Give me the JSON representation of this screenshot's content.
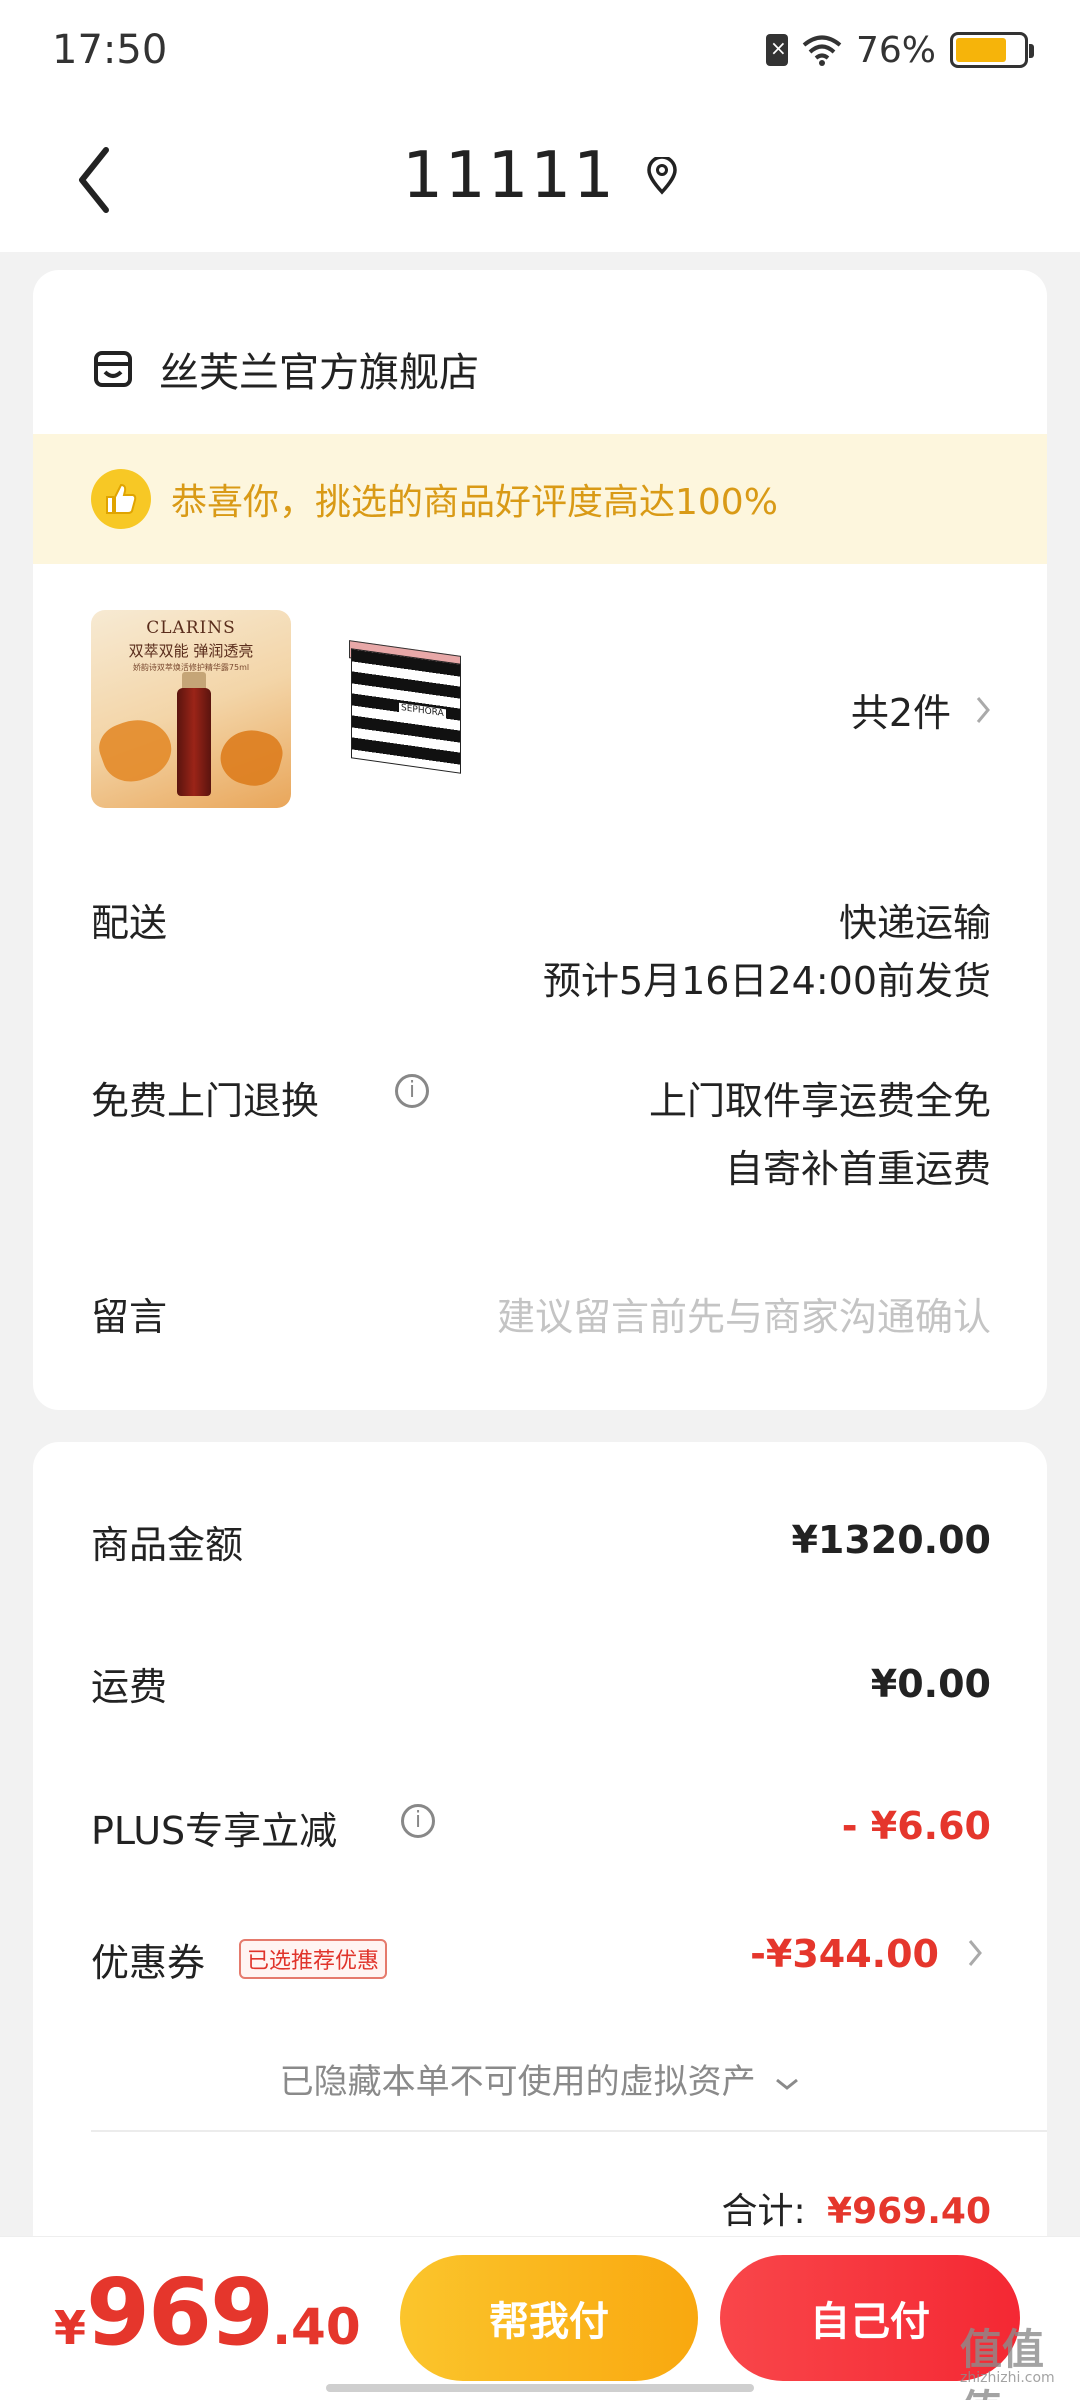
{
  "status_bar": {
    "time": "17:50",
    "battery": "76%",
    "battery_level": 0.76
  },
  "header": {
    "title": "11111"
  },
  "store": {
    "name": "丝芙兰官方旗舰店"
  },
  "banner": {
    "text": "恭喜你，挑选的商品好评度高达100%"
  },
  "products": {
    "item1": {
      "brand": "CLARINS",
      "tag": "双萃双能 弹润透亮",
      "sub": "娇韵诗双萃焕活修护精华露75ml"
    },
    "item2": {
      "label": "SEPHORA"
    },
    "count_text": "共2件"
  },
  "delivery": {
    "label": "配送",
    "method": "快递运输",
    "eta": "预计5月16日24:00前发货"
  },
  "returns": {
    "label": "免费上门退换",
    "line1": "上门取件享运费全免",
    "line2": "自寄补首重运费"
  },
  "remark": {
    "label": "留言",
    "placeholder": "建议留言前先与商家沟通确认"
  },
  "summary": {
    "goods_label": "商品金额",
    "goods_value": "¥1320.00",
    "shipping_label": "运费",
    "shipping_value": "¥0.00",
    "plus_label": "PLUS专享立减",
    "plus_value": "- ¥6.60",
    "coupon_label": "优惠券",
    "coupon_tag": "已选推荐优惠",
    "coupon_value": "-¥344.00",
    "hidden_assets": "已隐藏本单不可使用的虚拟资产",
    "total_label": "合计:",
    "total_value": "¥969.40"
  },
  "bottom": {
    "currency": "¥",
    "amount_int": "969",
    "amount_dec": ".40",
    "help_pay": "帮我付",
    "self_pay": "自己付"
  },
  "watermark": {
    "text": "值值值",
    "url": "zhizhizhi.com"
  },
  "colors": {
    "accent_red": "#e5362c",
    "accent_yellow": "#f9a80f",
    "banner_bg": "#fdf6dd"
  }
}
